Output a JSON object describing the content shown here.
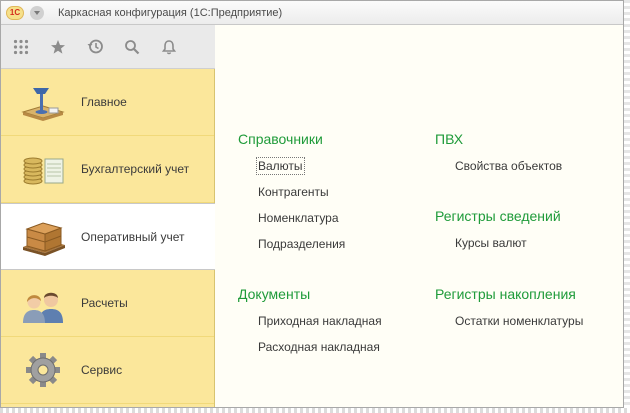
{
  "app": {
    "logo_text": "1С",
    "title": "Каркасная конфигурация  (1С:Предприятие)"
  },
  "toolbar": {
    "icons": [
      "apps-grid-icon",
      "star-icon",
      "history-icon",
      "search-icon",
      "bell-icon"
    ]
  },
  "sidebar": {
    "items": [
      {
        "label": "Главное",
        "icon": "desk-lamp-icon"
      },
      {
        "label": "Бухгалтерский учет",
        "icon": "coins-icon"
      },
      {
        "label": "Оперативный учет",
        "icon": "pallet-boxes-icon",
        "active": true
      },
      {
        "label": "Расчеты",
        "icon": "people-icon"
      },
      {
        "label": "Сервис",
        "icon": "gear-icon"
      }
    ]
  },
  "main": {
    "catalogs": {
      "title": "Справочники",
      "items": [
        "Валюты",
        "Контрагенты",
        "Номенклатура",
        "Подразделения"
      ]
    },
    "documents": {
      "title": "Документы",
      "items": [
        "Приходная накладная",
        "Расходная накладная"
      ]
    },
    "pvh": {
      "title": "ПВХ",
      "items": [
        "Свойства объектов"
      ]
    },
    "info_registers": {
      "title": "Регистры сведений",
      "items": [
        "Курсы валют"
      ]
    },
    "accum_registers": {
      "title": "Регистры накопления",
      "items": [
        "Остатки номенклатуры"
      ]
    }
  },
  "colors": {
    "sidebar_bg": "#fbe79b",
    "group_title": "#1f9b3a",
    "content_bg": "#fffef6"
  }
}
